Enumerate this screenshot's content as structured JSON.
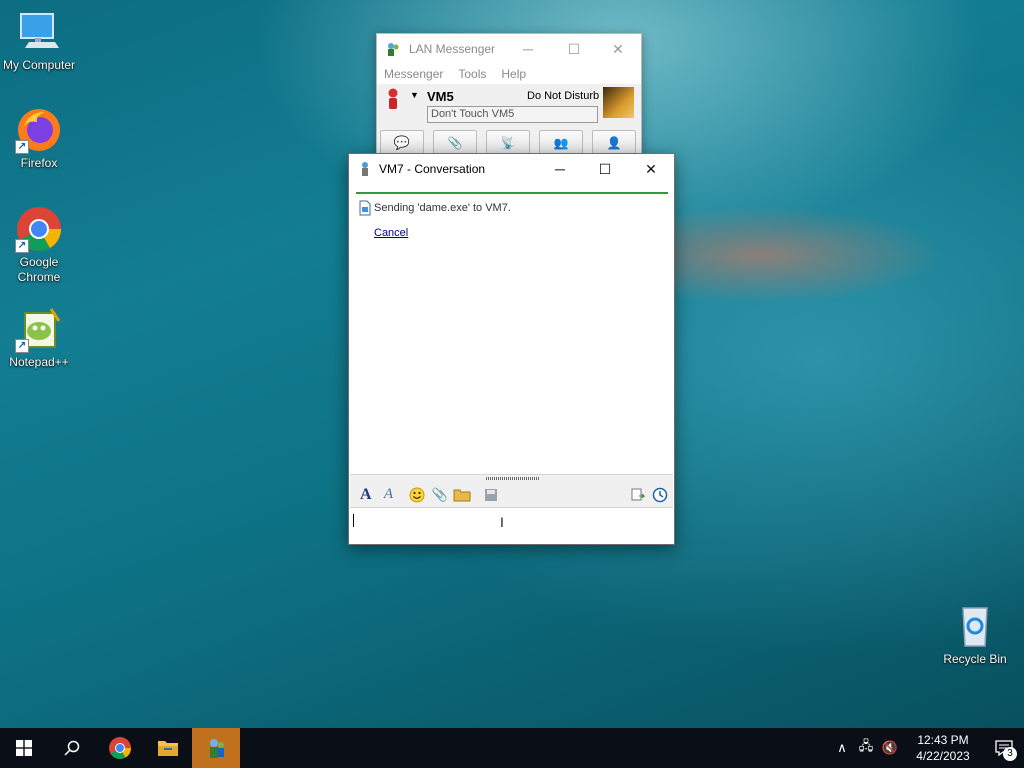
{
  "desktop": {
    "icons": [
      {
        "label": "My Computer"
      },
      {
        "label": "Firefox"
      },
      {
        "label": "Google Chrome"
      },
      {
        "label": "Notepad++"
      },
      {
        "label": "Recycle Bin"
      }
    ]
  },
  "main_window": {
    "title": "LAN Messenger",
    "menu": [
      "Messenger",
      "Tools",
      "Help"
    ],
    "user_name": "VM5",
    "status": "Do Not Disturb",
    "status_message": "Don't Touch VM5"
  },
  "conversation": {
    "title": "VM7 - Conversation",
    "transfer_text": "Sending 'dame.exe' to VM7.",
    "cancel_label": "Cancel",
    "input_value": ""
  },
  "taskbar": {
    "time": "12:43 PM",
    "date": "4/22/2023",
    "notification_count": "3"
  },
  "colors": {
    "taskbar_bg": "#0a0f17",
    "active_app": "#c1711d",
    "transfer_line": "#2f9a3a",
    "link": "#00008b"
  }
}
